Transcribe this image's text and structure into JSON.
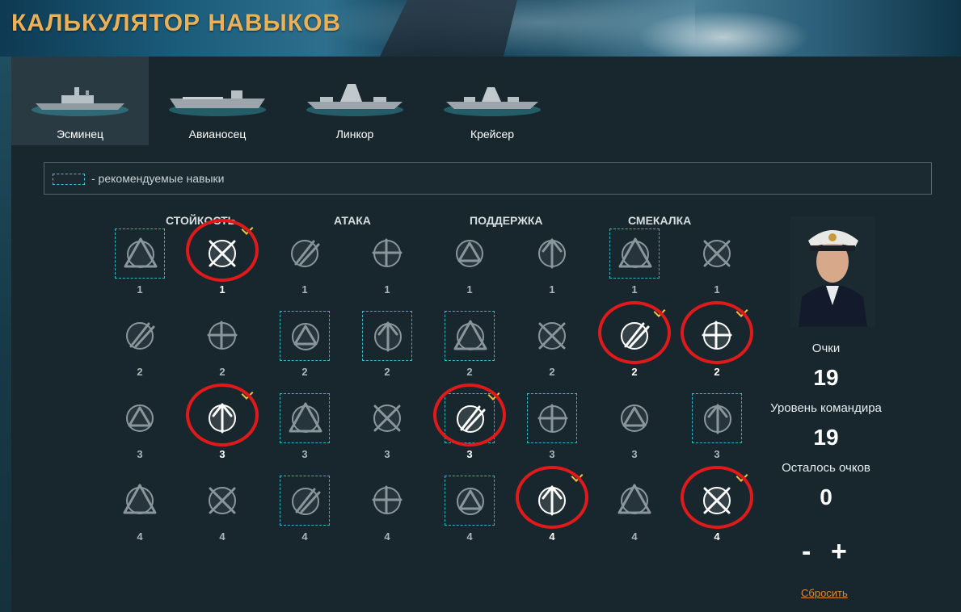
{
  "title": "КАЛЬКУЛЯТОР НАВЫКОВ",
  "tabs": [
    {
      "label": "Эсминец",
      "active": true
    },
    {
      "label": "Авианосец",
      "active": false
    },
    {
      "label": "Линкор",
      "active": false
    },
    {
      "label": "Крейсер",
      "active": false
    }
  ],
  "legend": {
    "text": "- рекомендуемые навыки"
  },
  "categories": [
    "СТОЙКОСТЬ",
    "АТАКА",
    "ПОДДЕРЖКА",
    "СМЕКАЛКА"
  ],
  "skill_rows": [
    {
      "cost": "1",
      "skills": [
        {
          "icon": "warning-timer-icon",
          "recommended": true,
          "selected": false
        },
        {
          "icon": "no-fire-flooding-icon",
          "recommended": false,
          "selected": true
        },
        {
          "icon": "torpedo-timer-icon",
          "recommended": false,
          "selected": false
        },
        {
          "icon": "plane-timer-icon",
          "recommended": false,
          "selected": false
        },
        {
          "icon": "plane-crosshair-icon",
          "recommended": false,
          "selected": false
        },
        {
          "icon": "aa-upgrade-icon",
          "recommended": false,
          "selected": false
        },
        {
          "icon": "torpedo-warning-icon",
          "recommended": true,
          "selected": false
        },
        {
          "icon": "plane-heal-icon",
          "recommended": false,
          "selected": false
        }
      ]
    },
    {
      "cost": "2",
      "skills": [
        {
          "icon": "wrench-timer-icon",
          "recommended": false,
          "selected": false
        },
        {
          "icon": "stopwatch-icon",
          "recommended": false,
          "selected": false
        },
        {
          "icon": "shells-timer-icon",
          "recommended": true,
          "selected": false
        },
        {
          "icon": "gun-upgrade-icon",
          "recommended": true,
          "selected": false
        },
        {
          "icon": "heart-upgrade-icon",
          "recommended": true,
          "selected": false
        },
        {
          "icon": "plane-upgrade-icon",
          "recommended": false,
          "selected": false
        },
        {
          "icon": "torpedo-reload-icon",
          "recommended": false,
          "selected": true
        },
        {
          "icon": "engine-wrench-icon",
          "recommended": false,
          "selected": true
        }
      ]
    },
    {
      "cost": "3",
      "skills": [
        {
          "icon": "wrench-upgrade-icon",
          "recommended": false,
          "selected": false
        },
        {
          "icon": "superstructure-upgrade-icon",
          "recommended": false,
          "selected": true
        },
        {
          "icon": "gun-timer-icon",
          "recommended": true,
          "selected": false
        },
        {
          "icon": "plane-fire-icon",
          "recommended": false,
          "selected": false
        },
        {
          "icon": "secondary-upgrade-icon",
          "recommended": true,
          "selected": true
        },
        {
          "icon": "aa-heal-icon",
          "recommended": true,
          "selected": false
        },
        {
          "icon": "torpedo-fire-icon",
          "recommended": false,
          "selected": false
        },
        {
          "icon": "gun-warning-icon",
          "recommended": true,
          "selected": false
        }
      ]
    },
    {
      "cost": "4",
      "skills": [
        {
          "icon": "shells-upgrade-icon",
          "recommended": false,
          "selected": false
        },
        {
          "icon": "extinguisher-icon",
          "recommended": false,
          "selected": false
        },
        {
          "icon": "guns-upgrade-icon",
          "recommended": true,
          "selected": false
        },
        {
          "icon": "planes-radar-icon",
          "recommended": false,
          "selected": false
        },
        {
          "icon": "aa-double-upgrade-icon",
          "recommended": true,
          "selected": false
        },
        {
          "icon": "aa-crosshair-icon",
          "recommended": false,
          "selected": true
        },
        {
          "icon": "radar-icon",
          "recommended": false,
          "selected": false
        },
        {
          "icon": "warning-down-icon",
          "recommended": false,
          "selected": true
        }
      ]
    }
  ],
  "panel": {
    "points_label": "Очки",
    "points_value": "19",
    "level_label": "Уровень командира",
    "level_value": "19",
    "remaining_label": "Осталось очков",
    "remaining_value": "0",
    "minus": "-",
    "plus": "+",
    "reset": "Сбросить"
  },
  "colors": {
    "background": "#18272e",
    "title": "#e8b15a",
    "recommended_border": "#2fb7c7",
    "selected_ring": "#e01a1a",
    "check_mark": "#f0c33c",
    "reset_link": "#e08a2c"
  }
}
